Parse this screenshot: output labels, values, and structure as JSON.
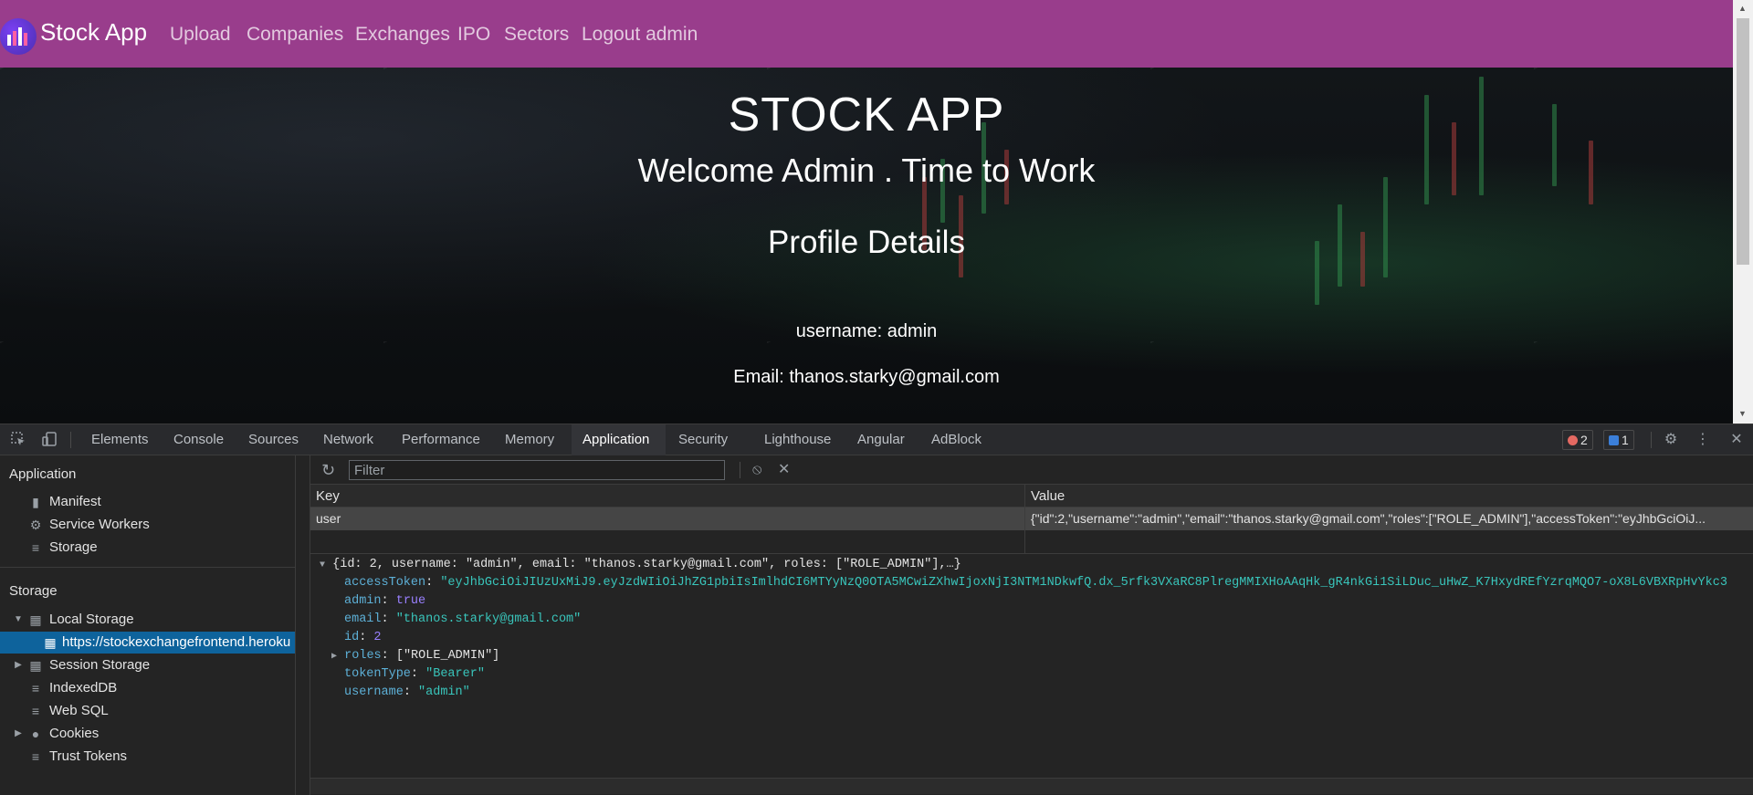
{
  "navbar": {
    "brand": "Stock App",
    "links": [
      "Upload",
      "Companies",
      "Exchanges",
      "IPO",
      "Sectors",
      "Logout admin"
    ]
  },
  "hero": {
    "title": "STOCK APP",
    "welcome": "Welcome Admin . Time to Work",
    "profile_heading": "Profile Details",
    "username_line": "username: admin",
    "email_line": "Email: thanos.starky@gmail.com"
  },
  "devtools": {
    "tabs": [
      "Elements",
      "Console",
      "Sources",
      "Network",
      "Performance",
      "Memory",
      "Application",
      "Security",
      "Lighthouse",
      "Angular",
      "AdBlock"
    ],
    "active_tab": "Application",
    "error_count": "2",
    "message_count": "1",
    "sidebar": {
      "application_header": "Application",
      "application_items": [
        "Manifest",
        "Service Workers",
        "Storage"
      ],
      "storage_header": "Storage",
      "local_storage": "Local Storage",
      "local_storage_origin": "https://stockexchangefrontend.heroku",
      "storage_items": [
        "Session Storage",
        "IndexedDB",
        "Web SQL",
        "Cookies",
        "Trust Tokens"
      ]
    },
    "toolbar": {
      "filter_placeholder": "Filter"
    },
    "table": {
      "key_header": "Key",
      "value_header": "Value",
      "row_key": "user",
      "row_value": "{\"id\":2,\"username\":\"admin\",\"email\":\"thanos.starky@gmail.com\",\"roles\":[\"ROLE_ADMIN\"],\"accessToken\":\"eyJhbGciOiJ..."
    },
    "preview": {
      "summary": "{id: 2, username: \"admin\", email: \"thanos.starky@gmail.com\", roles: [\"ROLE_ADMIN\"],…}",
      "access_token_key": "accessToken",
      "access_token_value": "\"eyJhbGciOiJIUzUxMiJ9.eyJzdWIiOiJhZG1pbiIsImlhdCI6MTYyNzQ0OTA5MCwiZXhwIjoxNjI3NTM1NDkwfQ.dx_5rfk3VXaRC8PlregMMIXHoAAqHk_gR4nkGi1SiLDuc_uHwZ_K7HxydREfYzrqMQO7-oX8L6VBXRpHvYkc3",
      "admin_key": "admin",
      "admin_value": "true",
      "email_key": "email",
      "email_value": "\"thanos.starky@gmail.com\"",
      "id_key": "id",
      "id_value": "2",
      "roles_key": "roles",
      "roles_value": "[\"ROLE_ADMIN\"]",
      "token_type_key": "tokenType",
      "token_type_value": "\"Bearer\"",
      "username_key": "username",
      "username_value": "\"admin\""
    }
  },
  "colors": {
    "navbar": "#993d8c",
    "devtools_bg": "#242424",
    "selection": "#0e639c",
    "json_key": "#5db0d7",
    "json_string": "#39c5bb",
    "json_bool": "#9980ff"
  }
}
